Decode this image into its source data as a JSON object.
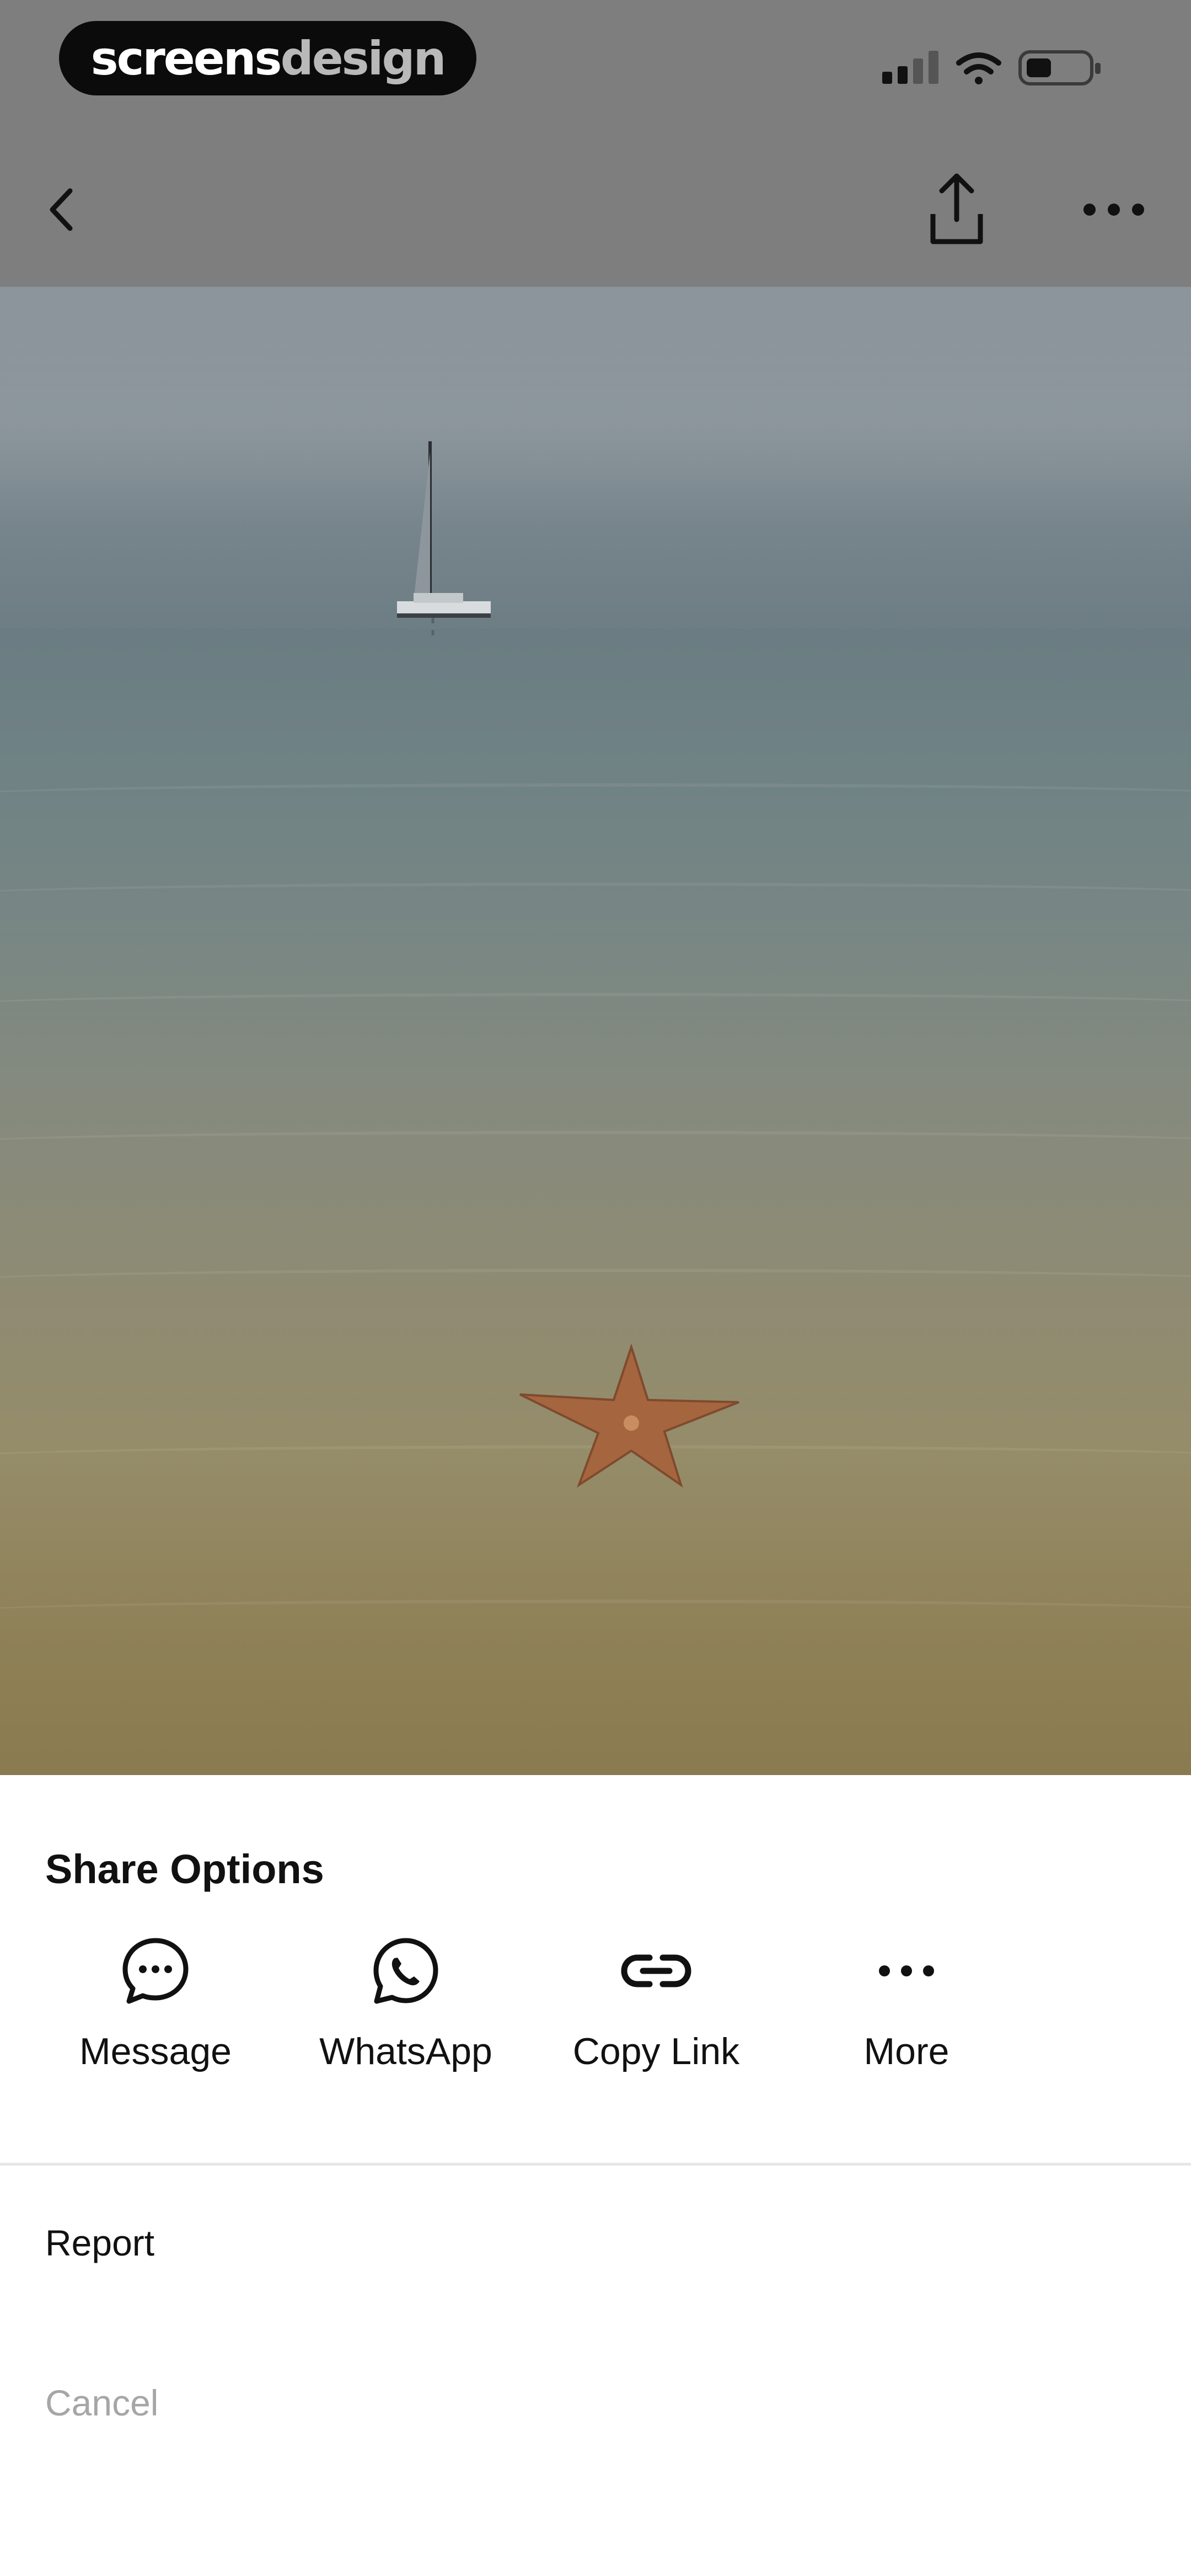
{
  "status_bar": {
    "brand_primary": "screens",
    "brand_secondary": "design",
    "icons": [
      "signal-icon",
      "wifi-icon",
      "battery-icon"
    ]
  },
  "nav": {
    "icons": [
      "back-icon",
      "share-upload-icon",
      "more-horizontal-icon"
    ]
  },
  "sheet": {
    "title": "Share Options",
    "share_targets": [
      {
        "label": "Message",
        "icon": "message-bubble-icon"
      },
      {
        "label": "WhatsApp",
        "icon": "whatsapp-icon"
      },
      {
        "label": "Copy Link",
        "icon": "link-icon"
      },
      {
        "label": "More",
        "icon": "more-horizontal-icon"
      }
    ],
    "report_label": "Report",
    "cancel_label": "Cancel"
  },
  "colors": {
    "overlay_dim": "#7e7e7e",
    "sheet_bg": "#ffffff",
    "text_primary": "#111111",
    "text_muted": "#a6a6a6",
    "divider": "#e6e6e6"
  }
}
